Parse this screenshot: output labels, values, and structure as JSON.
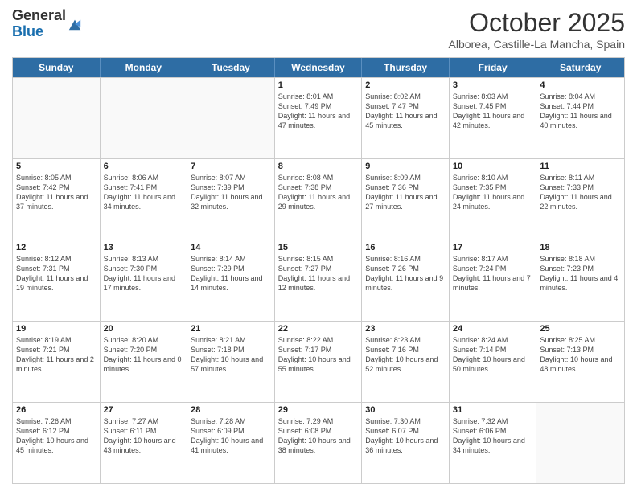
{
  "header": {
    "logo_general": "General",
    "logo_blue": "Blue",
    "month_title": "October 2025",
    "location": "Alborea, Castille-La Mancha, Spain"
  },
  "days_of_week": [
    "Sunday",
    "Monday",
    "Tuesday",
    "Wednesday",
    "Thursday",
    "Friday",
    "Saturday"
  ],
  "weeks": [
    [
      {
        "day": "",
        "sunrise": "",
        "sunset": "",
        "daylight": ""
      },
      {
        "day": "",
        "sunrise": "",
        "sunset": "",
        "daylight": ""
      },
      {
        "day": "",
        "sunrise": "",
        "sunset": "",
        "daylight": ""
      },
      {
        "day": "1",
        "sunrise": "Sunrise: 8:01 AM",
        "sunset": "Sunset: 7:49 PM",
        "daylight": "Daylight: 11 hours and 47 minutes."
      },
      {
        "day": "2",
        "sunrise": "Sunrise: 8:02 AM",
        "sunset": "Sunset: 7:47 PM",
        "daylight": "Daylight: 11 hours and 45 minutes."
      },
      {
        "day": "3",
        "sunrise": "Sunrise: 8:03 AM",
        "sunset": "Sunset: 7:45 PM",
        "daylight": "Daylight: 11 hours and 42 minutes."
      },
      {
        "day": "4",
        "sunrise": "Sunrise: 8:04 AM",
        "sunset": "Sunset: 7:44 PM",
        "daylight": "Daylight: 11 hours and 40 minutes."
      }
    ],
    [
      {
        "day": "5",
        "sunrise": "Sunrise: 8:05 AM",
        "sunset": "Sunset: 7:42 PM",
        "daylight": "Daylight: 11 hours and 37 minutes."
      },
      {
        "day": "6",
        "sunrise": "Sunrise: 8:06 AM",
        "sunset": "Sunset: 7:41 PM",
        "daylight": "Daylight: 11 hours and 34 minutes."
      },
      {
        "day": "7",
        "sunrise": "Sunrise: 8:07 AM",
        "sunset": "Sunset: 7:39 PM",
        "daylight": "Daylight: 11 hours and 32 minutes."
      },
      {
        "day": "8",
        "sunrise": "Sunrise: 8:08 AM",
        "sunset": "Sunset: 7:38 PM",
        "daylight": "Daylight: 11 hours and 29 minutes."
      },
      {
        "day": "9",
        "sunrise": "Sunrise: 8:09 AM",
        "sunset": "Sunset: 7:36 PM",
        "daylight": "Daylight: 11 hours and 27 minutes."
      },
      {
        "day": "10",
        "sunrise": "Sunrise: 8:10 AM",
        "sunset": "Sunset: 7:35 PM",
        "daylight": "Daylight: 11 hours and 24 minutes."
      },
      {
        "day": "11",
        "sunrise": "Sunrise: 8:11 AM",
        "sunset": "Sunset: 7:33 PM",
        "daylight": "Daylight: 11 hours and 22 minutes."
      }
    ],
    [
      {
        "day": "12",
        "sunrise": "Sunrise: 8:12 AM",
        "sunset": "Sunset: 7:31 PM",
        "daylight": "Daylight: 11 hours and 19 minutes."
      },
      {
        "day": "13",
        "sunrise": "Sunrise: 8:13 AM",
        "sunset": "Sunset: 7:30 PM",
        "daylight": "Daylight: 11 hours and 17 minutes."
      },
      {
        "day": "14",
        "sunrise": "Sunrise: 8:14 AM",
        "sunset": "Sunset: 7:29 PM",
        "daylight": "Daylight: 11 hours and 14 minutes."
      },
      {
        "day": "15",
        "sunrise": "Sunrise: 8:15 AM",
        "sunset": "Sunset: 7:27 PM",
        "daylight": "Daylight: 11 hours and 12 minutes."
      },
      {
        "day": "16",
        "sunrise": "Sunrise: 8:16 AM",
        "sunset": "Sunset: 7:26 PM",
        "daylight": "Daylight: 11 hours and 9 minutes."
      },
      {
        "day": "17",
        "sunrise": "Sunrise: 8:17 AM",
        "sunset": "Sunset: 7:24 PM",
        "daylight": "Daylight: 11 hours and 7 minutes."
      },
      {
        "day": "18",
        "sunrise": "Sunrise: 8:18 AM",
        "sunset": "Sunset: 7:23 PM",
        "daylight": "Daylight: 11 hours and 4 minutes."
      }
    ],
    [
      {
        "day": "19",
        "sunrise": "Sunrise: 8:19 AM",
        "sunset": "Sunset: 7:21 PM",
        "daylight": "Daylight: 11 hours and 2 minutes."
      },
      {
        "day": "20",
        "sunrise": "Sunrise: 8:20 AM",
        "sunset": "Sunset: 7:20 PM",
        "daylight": "Daylight: 11 hours and 0 minutes."
      },
      {
        "day": "21",
        "sunrise": "Sunrise: 8:21 AM",
        "sunset": "Sunset: 7:18 PM",
        "daylight": "Daylight: 10 hours and 57 minutes."
      },
      {
        "day": "22",
        "sunrise": "Sunrise: 8:22 AM",
        "sunset": "Sunset: 7:17 PM",
        "daylight": "Daylight: 10 hours and 55 minutes."
      },
      {
        "day": "23",
        "sunrise": "Sunrise: 8:23 AM",
        "sunset": "Sunset: 7:16 PM",
        "daylight": "Daylight: 10 hours and 52 minutes."
      },
      {
        "day": "24",
        "sunrise": "Sunrise: 8:24 AM",
        "sunset": "Sunset: 7:14 PM",
        "daylight": "Daylight: 10 hours and 50 minutes."
      },
      {
        "day": "25",
        "sunrise": "Sunrise: 8:25 AM",
        "sunset": "Sunset: 7:13 PM",
        "daylight": "Daylight: 10 hours and 48 minutes."
      }
    ],
    [
      {
        "day": "26",
        "sunrise": "Sunrise: 7:26 AM",
        "sunset": "Sunset: 6:12 PM",
        "daylight": "Daylight: 10 hours and 45 minutes."
      },
      {
        "day": "27",
        "sunrise": "Sunrise: 7:27 AM",
        "sunset": "Sunset: 6:11 PM",
        "daylight": "Daylight: 10 hours and 43 minutes."
      },
      {
        "day": "28",
        "sunrise": "Sunrise: 7:28 AM",
        "sunset": "Sunset: 6:09 PM",
        "daylight": "Daylight: 10 hours and 41 minutes."
      },
      {
        "day": "29",
        "sunrise": "Sunrise: 7:29 AM",
        "sunset": "Sunset: 6:08 PM",
        "daylight": "Daylight: 10 hours and 38 minutes."
      },
      {
        "day": "30",
        "sunrise": "Sunrise: 7:30 AM",
        "sunset": "Sunset: 6:07 PM",
        "daylight": "Daylight: 10 hours and 36 minutes."
      },
      {
        "day": "31",
        "sunrise": "Sunrise: 7:32 AM",
        "sunset": "Sunset: 6:06 PM",
        "daylight": "Daylight: 10 hours and 34 minutes."
      },
      {
        "day": "",
        "sunrise": "",
        "sunset": "",
        "daylight": ""
      }
    ]
  ]
}
